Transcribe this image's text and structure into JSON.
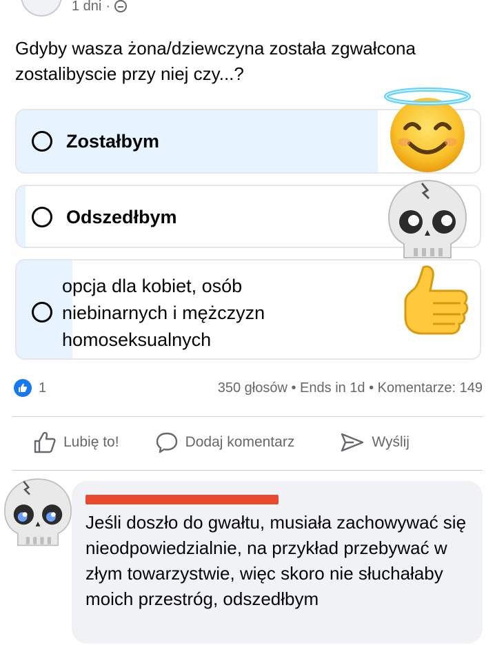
{
  "post": {
    "time": "1 dni",
    "separator": "·",
    "question": "Gdyby wasza żona/dziewczyna została zgwałcona zostalibyscie przy niej czy...?"
  },
  "poll": {
    "options": [
      {
        "label": "Zostałbym",
        "vote_share": 0.78
      },
      {
        "label": "Odszedłbym",
        "vote_share": 0.02
      },
      {
        "label": "opcja dla kobiet, osób niebinarnych i mężczyzn homoseksualnych",
        "vote_share": 0.12
      }
    ],
    "option3_lines": [
      "opcja dla kobiet, osób",
      "niebinarnych i mężczyzn",
      "homoseksualnych"
    ]
  },
  "stats": {
    "likes": "1",
    "summary": "350 głosów • Ends in 1d • Komentarze: 149"
  },
  "actions": {
    "like": "Lubię to!",
    "comment": "Dodaj komentarz",
    "send": "Wyślij"
  },
  "comment": {
    "text": "Jeśli doszło do gwałtu, musiała zachowywać się nieodpowiedzialnie, na przykład przebywać w złym towarzystwie, więc skoro nie słuchałaby moich przestróg, odszedłbym"
  },
  "icons": {
    "audience": "friends-icon",
    "like_badge": "thumbs-up-icon",
    "like_action": "thumbs-up-outline-icon",
    "comment_action": "speech-bubble-icon",
    "send_action": "send-arrow-icon",
    "overlay_emojis": [
      "smiling-face-with-halo-emoji",
      "skull-emoji",
      "thumbs-up-emoji",
      "skull-emoji"
    ]
  },
  "colors": {
    "accent": "#1877f2",
    "poll_fill": "#e7f3ff",
    "secondary_text": "#65676b",
    "redaction": "#e84a2f"
  }
}
